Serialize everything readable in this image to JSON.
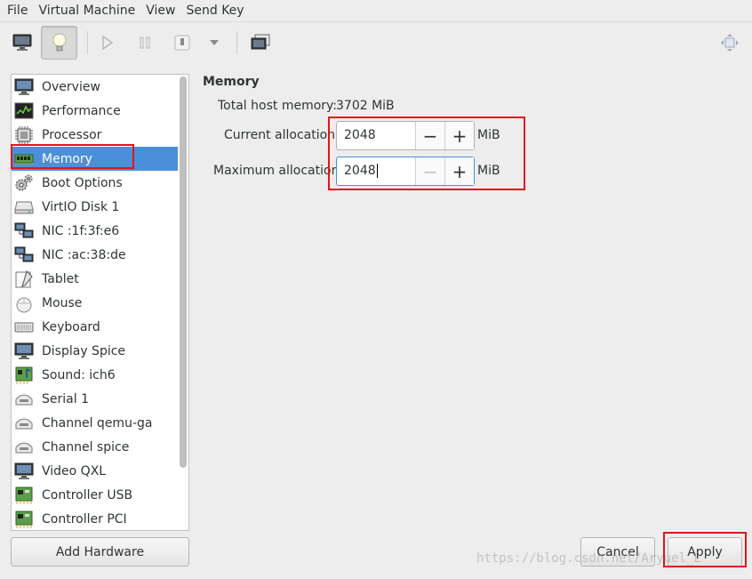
{
  "menubar": [
    "File",
    "Virtual Machine",
    "View",
    "Send Key"
  ],
  "toolbar": {
    "buttons": [
      "console-icon",
      "details-lightbulb-icon",
      "run-icon",
      "pause-icon",
      "shutdown-icon",
      "dropdown-arrow-icon",
      "snapshots-icon",
      "fullscreen-icon"
    ]
  },
  "sidebar": {
    "items": [
      {
        "label": "Overview",
        "icon": "monitor-icon"
      },
      {
        "label": "Performance",
        "icon": "performance-graph-icon"
      },
      {
        "label": "Processor",
        "icon": "cpu-chip-icon"
      },
      {
        "label": "Memory",
        "icon": "memory-module-icon"
      },
      {
        "label": "Boot Options",
        "icon": "gears-icon"
      },
      {
        "label": "VirtIO Disk 1",
        "icon": "disk-drive-icon"
      },
      {
        "label": "NIC :1f:3f:e6",
        "icon": "network-icon"
      },
      {
        "label": "NIC :ac:38:de",
        "icon": "network-icon"
      },
      {
        "label": "Tablet",
        "icon": "tablet-icon"
      },
      {
        "label": "Mouse",
        "icon": "mouse-icon"
      },
      {
        "label": "Keyboard",
        "icon": "keyboard-icon"
      },
      {
        "label": "Display Spice",
        "icon": "display-icon"
      },
      {
        "label": "Sound: ich6",
        "icon": "sound-card-icon"
      },
      {
        "label": "Serial 1",
        "icon": "serial-port-icon"
      },
      {
        "label": "Channel qemu-ga",
        "icon": "channel-icon"
      },
      {
        "label": "Channel spice",
        "icon": "channel-icon"
      },
      {
        "label": "Video QXL",
        "icon": "video-card-icon"
      },
      {
        "label": "Controller USB",
        "icon": "controller-card-icon"
      },
      {
        "label": "Controller PCI",
        "icon": "controller-card-icon"
      }
    ],
    "selected": "Memory",
    "add_hardware_label": "Add Hardware"
  },
  "memory": {
    "section_title": "Memory",
    "total_host_label": "Total host memory:",
    "total_host_value": "3702 MiB",
    "current_label": "Current allocation",
    "current_value": "2048",
    "current_unit": "MiB",
    "maximum_label": "Maximum allocation",
    "maximum_value": "2048",
    "maximum_unit": "MiB",
    "minus_glyph": "−",
    "plus_glyph": "+"
  },
  "footer": {
    "cancel_label": "Cancel",
    "apply_label": "Apply"
  },
  "watermark": "https://blog.csdn.net/Aryuel_L",
  "colors": {
    "selection": "#4a90d9",
    "highlight_box": "#e0141e"
  }
}
